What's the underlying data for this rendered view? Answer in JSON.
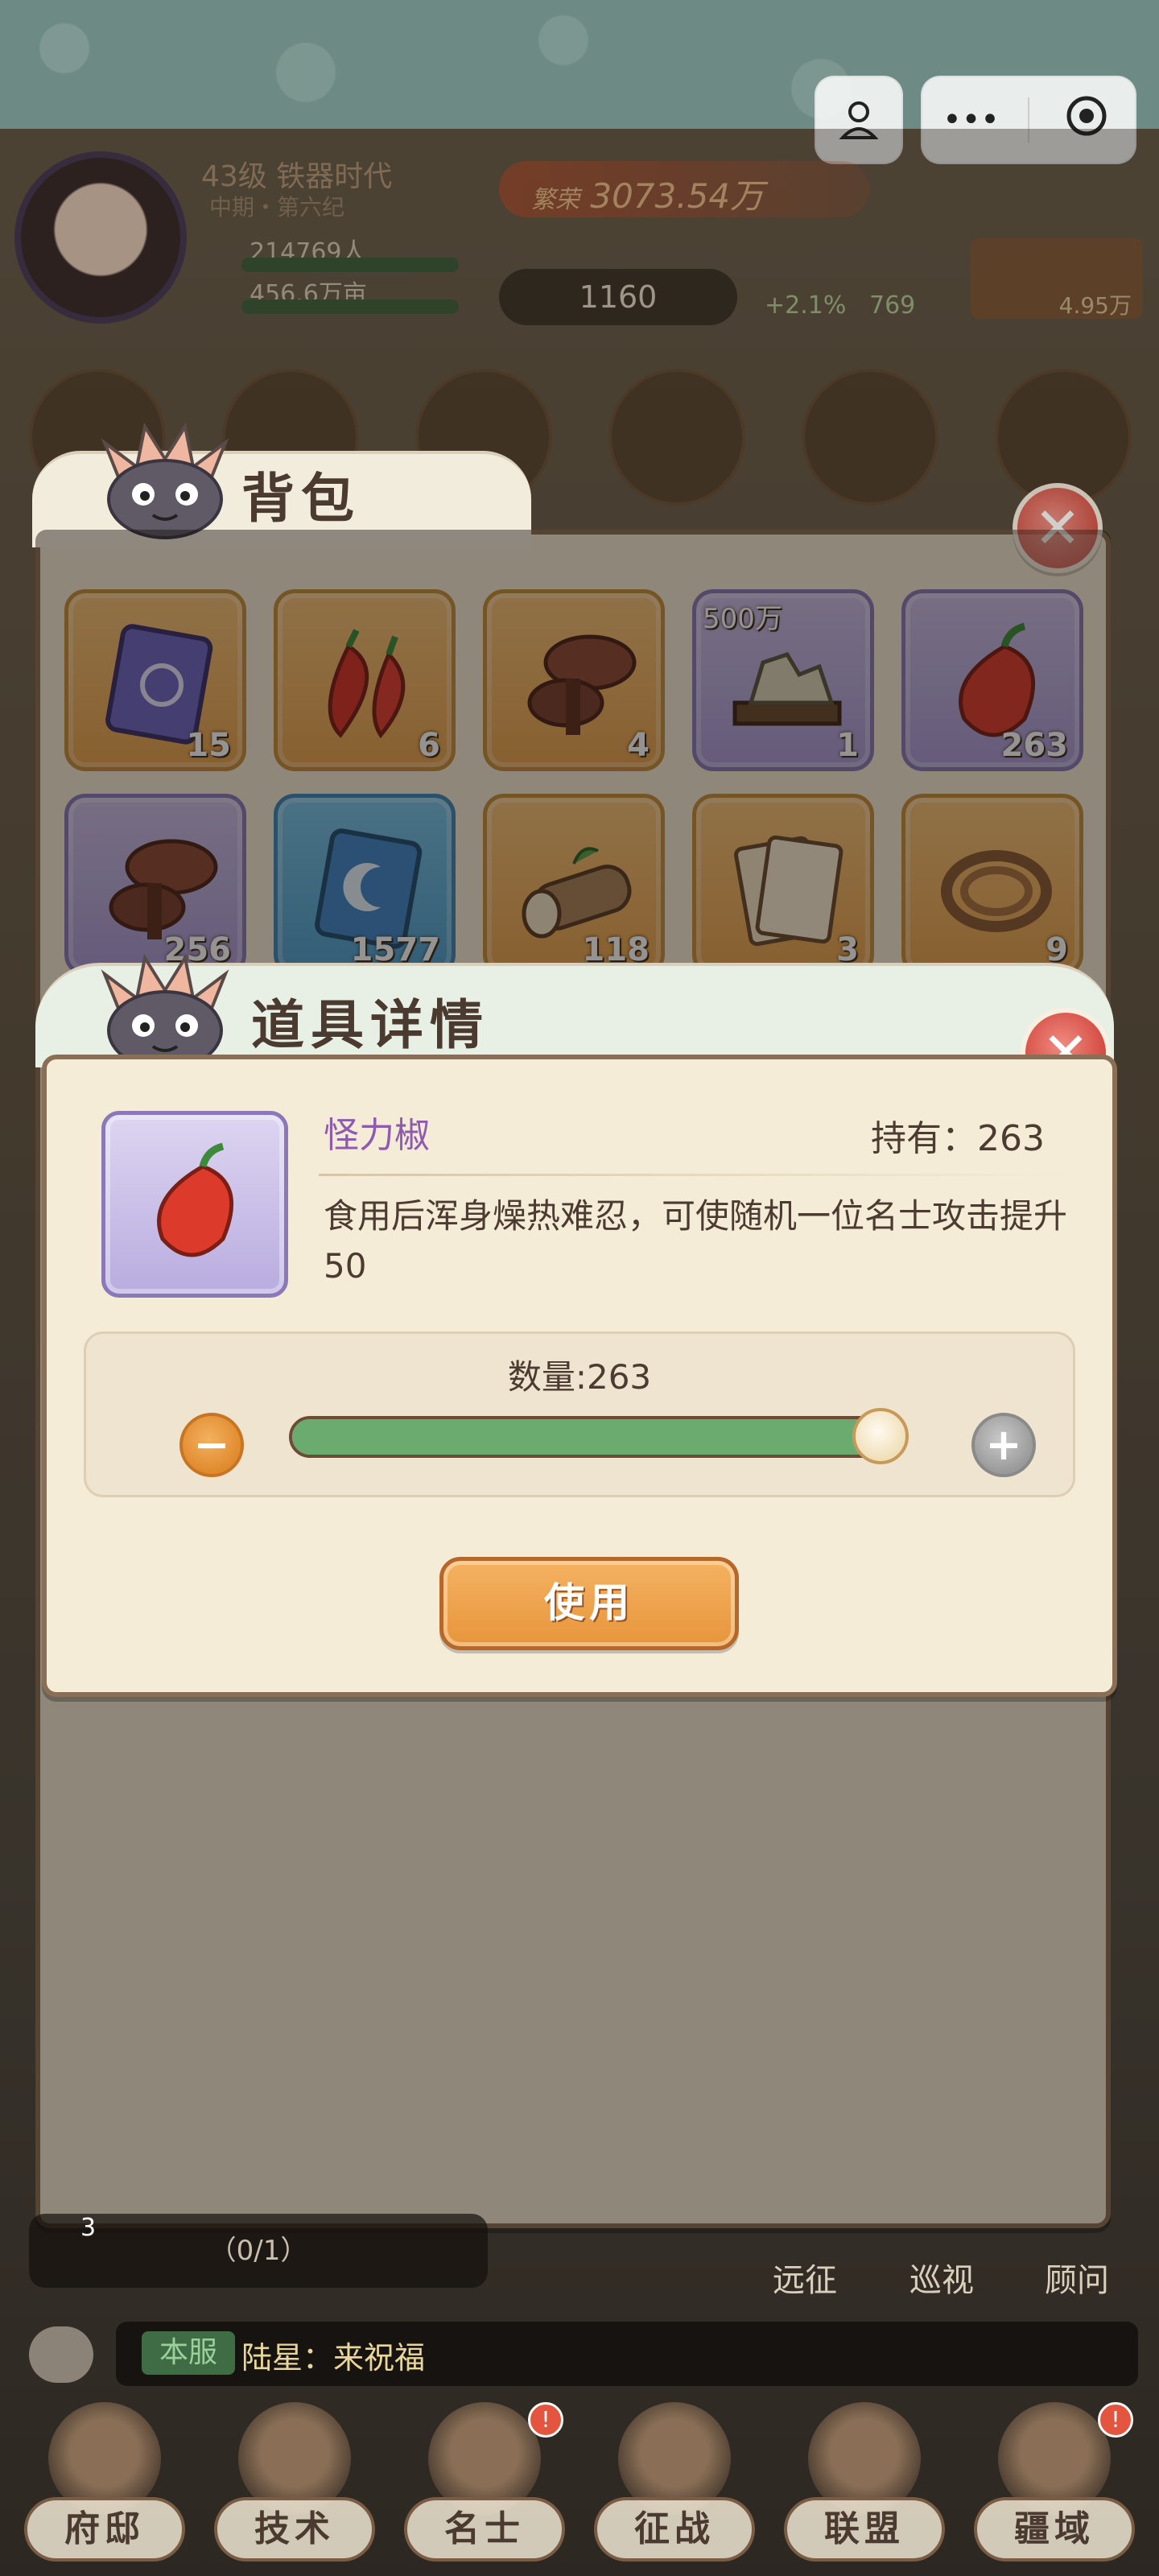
{
  "status": {
    "level_era": "43级 铁器时代",
    "era_sub": "中期・第六纪",
    "population": "214769人",
    "land": "456.6万亩",
    "prosperity_label": "繁荣",
    "prosperity_value": "3073.54万",
    "coins": "1160",
    "growth": "+2.1%",
    "gems": "769",
    "gold": "4.95万"
  },
  "capsule": {
    "menu_icon": "more-icon",
    "close_icon": "target-icon",
    "user_icon": "user-icon"
  },
  "bag": {
    "title": "背包",
    "slots": [
      {
        "item": "scroll-card",
        "count": "15",
        "rarity": "orange"
      },
      {
        "item": "chili-peppers",
        "count": "6",
        "rarity": "orange"
      },
      {
        "item": "lingzhi-mushroom",
        "count": "4",
        "rarity": "orange"
      },
      {
        "item": "stone-ore",
        "count": "1",
        "rarity": "purple",
        "tag": "500万"
      },
      {
        "item": "red-pepper",
        "count": "263",
        "rarity": "purple"
      },
      {
        "item": "lingzhi-mushroom",
        "count": "256",
        "rarity": "purple"
      },
      {
        "item": "moon-card",
        "count": "1577",
        "rarity": "blue"
      },
      {
        "item": "wood-log",
        "count": "118",
        "rarity": "orange"
      },
      {
        "item": "playing-cards",
        "count": "3",
        "rarity": "orange"
      },
      {
        "item": "rope-coil",
        "count": "9",
        "rarity": "orange"
      }
    ]
  },
  "detail": {
    "title": "道具详情",
    "item_name": "怪力椒",
    "own_label": "持有：263",
    "description": "食用后浑身燥热难忍，可使随机一位名士攻击提升50",
    "quantity_label": "数量:263",
    "quantity": 263,
    "quantity_max": 263,
    "use_label": "使用"
  },
  "bottom": {
    "quest_progress": "（0/1）",
    "quest_badge": "3",
    "side_buttons": [
      "远征",
      "巡视",
      "顾问"
    ],
    "chat_server": "本服",
    "chat_message": "陆星：来祝福"
  },
  "nav": {
    "items": [
      {
        "label": "府邸",
        "icon": "mansion-icon"
      },
      {
        "label": "技术",
        "icon": "wheat-icon"
      },
      {
        "label": "名士",
        "icon": "scholar-icon"
      },
      {
        "label": "征战",
        "icon": "target-icon"
      },
      {
        "label": "联盟",
        "icon": "banner-icon"
      },
      {
        "label": "疆域",
        "icon": "map-icon"
      }
    ]
  },
  "colors": {
    "accent_orange": "#e7953b",
    "rarity_purple": "#a99ad6",
    "rarity_blue": "#4b9fcf",
    "progress_green": "#6bab6f",
    "close_red": "#d2483f"
  }
}
